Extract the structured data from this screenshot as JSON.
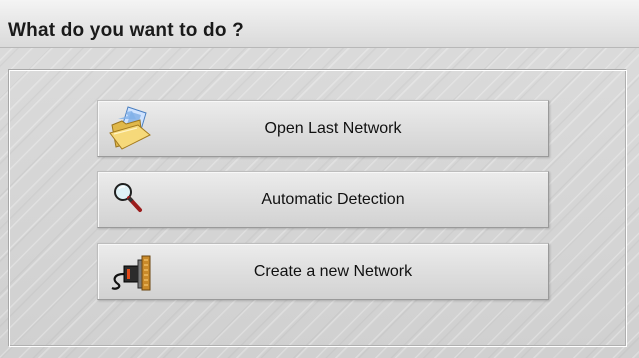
{
  "window": {
    "title": "What do you want to do ?"
  },
  "actions": [
    {
      "label": "Open Last Network",
      "icon": "folder-open-icon"
    },
    {
      "label": "Automatic Detection",
      "icon": "magnifier-icon"
    },
    {
      "label": "Create a new Network",
      "icon": "serial-connector-icon"
    }
  ],
  "colors": {
    "background": "#d6d6d6",
    "title_text": "#1a1a1a",
    "button_face": "#e1e1e1"
  }
}
